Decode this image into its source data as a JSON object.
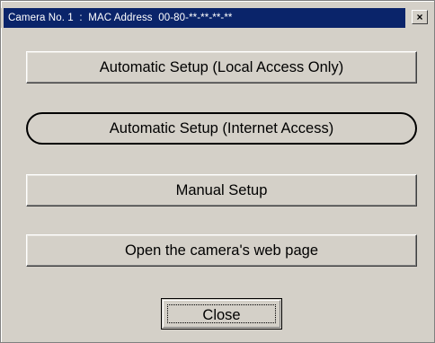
{
  "window": {
    "title": "Camera No. 1  :  MAC Address  00-80-**-**-**-**",
    "close_glyph": "×"
  },
  "buttons": {
    "auto_local": "Automatic Setup (Local Access Only)",
    "auto_internet": "Automatic Setup (Internet Access)",
    "manual": "Manual Setup",
    "web_page": "Open the camera's web page",
    "close": "Close"
  },
  "colors": {
    "titlebar": "#0a246a",
    "face": "#d4d0c8"
  }
}
